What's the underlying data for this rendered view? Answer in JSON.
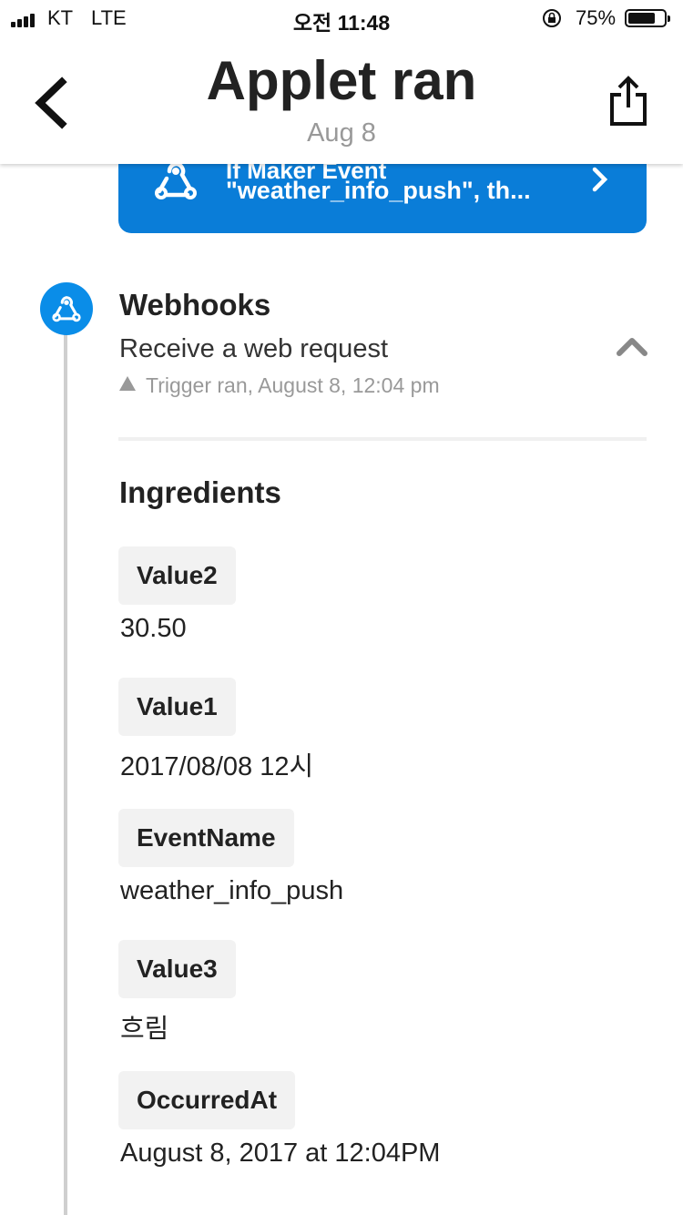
{
  "status_bar": {
    "carrier": "KT",
    "network": "LTE",
    "time": "오전 11:48",
    "battery_percent": "75%",
    "battery_level": 0.75
  },
  "header": {
    "title": "Applet ran",
    "date": "Aug 8"
  },
  "action_card": {
    "line1": "If Maker Event",
    "line2": "\"weather_info_push\", th...",
    "color": "#0a7dd8"
  },
  "service": {
    "name": "Webhooks",
    "trigger": "Receive a web request",
    "status": "Trigger ran, August 8, 12:04 pm",
    "badge_color": "#0a8de8"
  },
  "ingredients": {
    "title": "Ingredients",
    "items": [
      {
        "label": "Value2",
        "value": "30.50"
      },
      {
        "label": "Value1",
        "value": "2017/08/08 12시"
      },
      {
        "label": "EventName",
        "value": "weather_info_push"
      },
      {
        "label": "Value3",
        "value": "흐림"
      },
      {
        "label": "OccurredAt",
        "value": "August 8, 2017 at 12:04PM"
      }
    ]
  }
}
